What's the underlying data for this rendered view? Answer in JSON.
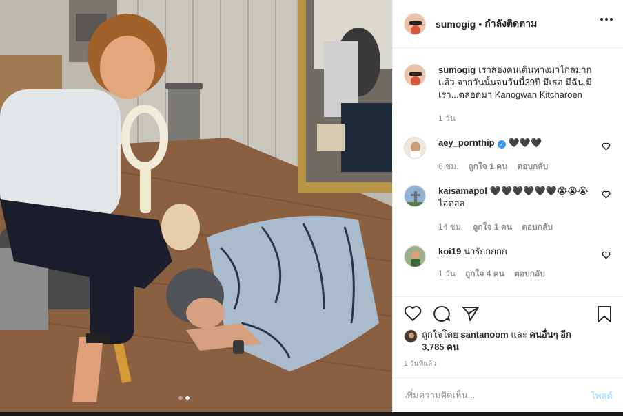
{
  "header": {
    "username": "sumogig",
    "separator": "•",
    "follow_status": "กำลังติดตาม"
  },
  "caption": {
    "username": "sumogig",
    "text": "เราสองคนเดินทางมาไกลมากแล้ว จากวันนั้นจนวันนี้39ปี มีเธอ มีฉัน มีเรา...ตลอดมา Kanogwan Kitcharoen",
    "time": "1 วัน"
  },
  "comments": [
    {
      "username": "aey_pornthip",
      "verified": true,
      "text": "🖤🖤🖤",
      "time": "6 ชม.",
      "likes": "ถูกใจ 1 คน",
      "reply": "ตอบกลับ"
    },
    {
      "username": "kaisamapol",
      "verified": false,
      "text": "🖤🖤🖤🖤🖤🖤😭😭😭 ไอดอล",
      "time": "14 ชม.",
      "likes": "ถูกใจ 1 คน",
      "reply": "ตอบกลับ"
    },
    {
      "username": "koi19",
      "verified": false,
      "text": "น่ารักกกกก",
      "time": "1 วัน",
      "likes": "ถูกใจ 4 คน",
      "reply": "ตอบกลับ"
    }
  ],
  "likes": {
    "prefix": "ถูกใจโดย",
    "user": "santanoom",
    "conj": "และ",
    "others": "คนอื่นๆ อีก 3,785 คน"
  },
  "time_ago": "1 วันที่แล้ว",
  "add_comment": {
    "placeholder": "เพิ่มความคิดเห็น...",
    "post_label": "โพสต์"
  },
  "carousel": {
    "count": 2,
    "active_index": 1
  },
  "colors": {
    "link_blue": "#3897f0",
    "disabled_blue": "#b2dffc",
    "secondary_text": "#8e8e8e"
  }
}
